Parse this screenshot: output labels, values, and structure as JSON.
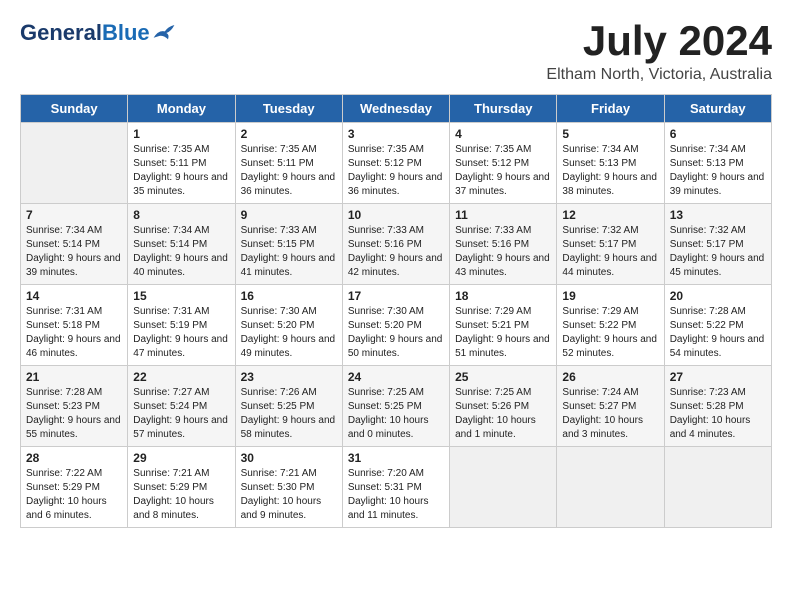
{
  "header": {
    "logo_general": "General",
    "logo_blue": "Blue",
    "month_title": "July 2024",
    "location": "Eltham North, Victoria, Australia"
  },
  "calendar": {
    "days_of_week": [
      "Sunday",
      "Monday",
      "Tuesday",
      "Wednesday",
      "Thursday",
      "Friday",
      "Saturday"
    ],
    "weeks": [
      [
        {
          "day": "",
          "info": ""
        },
        {
          "day": "1",
          "info": "Sunrise: 7:35 AM\nSunset: 5:11 PM\nDaylight: 9 hours and 35 minutes."
        },
        {
          "day": "2",
          "info": "Sunrise: 7:35 AM\nSunset: 5:11 PM\nDaylight: 9 hours and 36 minutes."
        },
        {
          "day": "3",
          "info": "Sunrise: 7:35 AM\nSunset: 5:12 PM\nDaylight: 9 hours and 36 minutes."
        },
        {
          "day": "4",
          "info": "Sunrise: 7:35 AM\nSunset: 5:12 PM\nDaylight: 9 hours and 37 minutes."
        },
        {
          "day": "5",
          "info": "Sunrise: 7:34 AM\nSunset: 5:13 PM\nDaylight: 9 hours and 38 minutes."
        },
        {
          "day": "6",
          "info": "Sunrise: 7:34 AM\nSunset: 5:13 PM\nDaylight: 9 hours and 39 minutes."
        }
      ],
      [
        {
          "day": "7",
          "info": "Sunrise: 7:34 AM\nSunset: 5:14 PM\nDaylight: 9 hours and 39 minutes."
        },
        {
          "day": "8",
          "info": "Sunrise: 7:34 AM\nSunset: 5:14 PM\nDaylight: 9 hours and 40 minutes."
        },
        {
          "day": "9",
          "info": "Sunrise: 7:33 AM\nSunset: 5:15 PM\nDaylight: 9 hours and 41 minutes."
        },
        {
          "day": "10",
          "info": "Sunrise: 7:33 AM\nSunset: 5:16 PM\nDaylight: 9 hours and 42 minutes."
        },
        {
          "day": "11",
          "info": "Sunrise: 7:33 AM\nSunset: 5:16 PM\nDaylight: 9 hours and 43 minutes."
        },
        {
          "day": "12",
          "info": "Sunrise: 7:32 AM\nSunset: 5:17 PM\nDaylight: 9 hours and 44 minutes."
        },
        {
          "day": "13",
          "info": "Sunrise: 7:32 AM\nSunset: 5:17 PM\nDaylight: 9 hours and 45 minutes."
        }
      ],
      [
        {
          "day": "14",
          "info": "Sunrise: 7:31 AM\nSunset: 5:18 PM\nDaylight: 9 hours and 46 minutes."
        },
        {
          "day": "15",
          "info": "Sunrise: 7:31 AM\nSunset: 5:19 PM\nDaylight: 9 hours and 47 minutes."
        },
        {
          "day": "16",
          "info": "Sunrise: 7:30 AM\nSunset: 5:20 PM\nDaylight: 9 hours and 49 minutes."
        },
        {
          "day": "17",
          "info": "Sunrise: 7:30 AM\nSunset: 5:20 PM\nDaylight: 9 hours and 50 minutes."
        },
        {
          "day": "18",
          "info": "Sunrise: 7:29 AM\nSunset: 5:21 PM\nDaylight: 9 hours and 51 minutes."
        },
        {
          "day": "19",
          "info": "Sunrise: 7:29 AM\nSunset: 5:22 PM\nDaylight: 9 hours and 52 minutes."
        },
        {
          "day": "20",
          "info": "Sunrise: 7:28 AM\nSunset: 5:22 PM\nDaylight: 9 hours and 54 minutes."
        }
      ],
      [
        {
          "day": "21",
          "info": "Sunrise: 7:28 AM\nSunset: 5:23 PM\nDaylight: 9 hours and 55 minutes."
        },
        {
          "day": "22",
          "info": "Sunrise: 7:27 AM\nSunset: 5:24 PM\nDaylight: 9 hours and 57 minutes."
        },
        {
          "day": "23",
          "info": "Sunrise: 7:26 AM\nSunset: 5:25 PM\nDaylight: 9 hours and 58 minutes."
        },
        {
          "day": "24",
          "info": "Sunrise: 7:25 AM\nSunset: 5:25 PM\nDaylight: 10 hours and 0 minutes."
        },
        {
          "day": "25",
          "info": "Sunrise: 7:25 AM\nSunset: 5:26 PM\nDaylight: 10 hours and 1 minute."
        },
        {
          "day": "26",
          "info": "Sunrise: 7:24 AM\nSunset: 5:27 PM\nDaylight: 10 hours and 3 minutes."
        },
        {
          "day": "27",
          "info": "Sunrise: 7:23 AM\nSunset: 5:28 PM\nDaylight: 10 hours and 4 minutes."
        }
      ],
      [
        {
          "day": "28",
          "info": "Sunrise: 7:22 AM\nSunset: 5:29 PM\nDaylight: 10 hours and 6 minutes."
        },
        {
          "day": "29",
          "info": "Sunrise: 7:21 AM\nSunset: 5:29 PM\nDaylight: 10 hours and 8 minutes."
        },
        {
          "day": "30",
          "info": "Sunrise: 7:21 AM\nSunset: 5:30 PM\nDaylight: 10 hours and 9 minutes."
        },
        {
          "day": "31",
          "info": "Sunrise: 7:20 AM\nSunset: 5:31 PM\nDaylight: 10 hours and 11 minutes."
        },
        {
          "day": "",
          "info": ""
        },
        {
          "day": "",
          "info": ""
        },
        {
          "day": "",
          "info": ""
        }
      ]
    ]
  }
}
